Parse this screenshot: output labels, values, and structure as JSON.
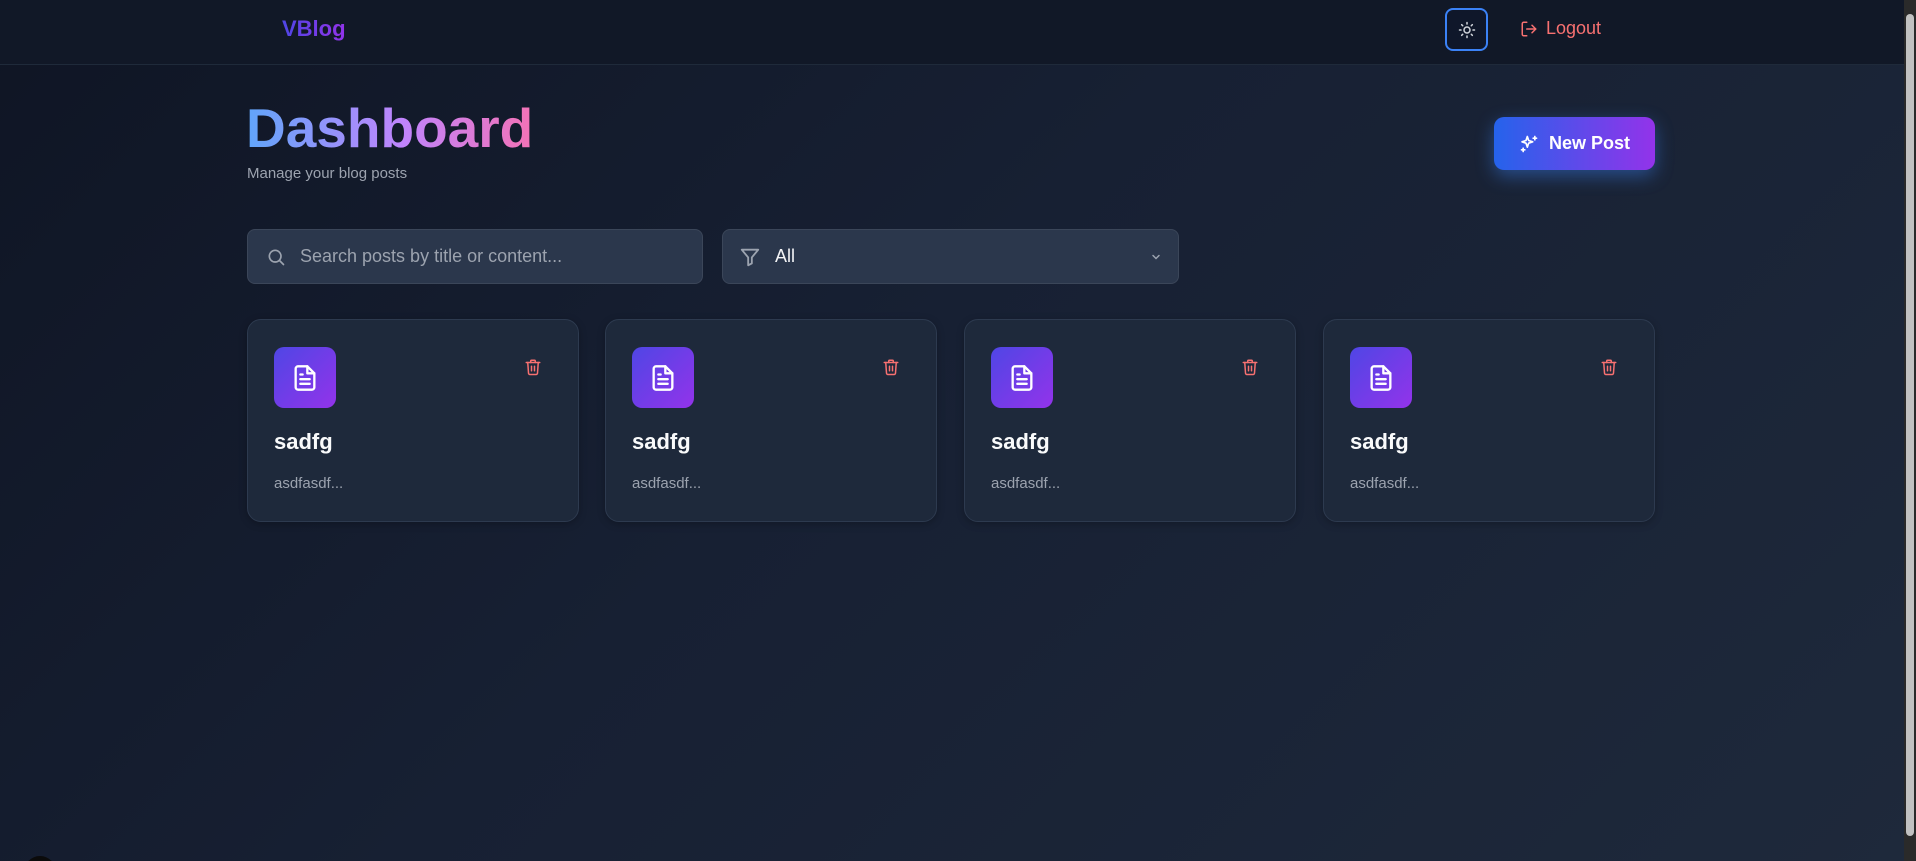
{
  "nav": {
    "logo": "VBlog",
    "logout_label": "Logout"
  },
  "header": {
    "title": "Dashboard",
    "subtitle": "Manage your blog posts",
    "new_post_label": "New Post"
  },
  "filters": {
    "search_placeholder": "Search posts by title or content...",
    "filter_value": "All"
  },
  "posts": [
    {
      "title": "sadfg",
      "excerpt": "asdfasdf..."
    },
    {
      "title": "sadfg",
      "excerpt": "asdfasdf..."
    },
    {
      "title": "sadfg",
      "excerpt": "asdfasdf..."
    },
    {
      "title": "sadfg",
      "excerpt": "asdfasdf..."
    }
  ],
  "icons": {
    "theme_toggle": "sun-icon",
    "logout": "logout-icon",
    "new_post": "sparkles-icon",
    "search": "search-icon",
    "filter": "filter-icon",
    "post": "file-text-icon",
    "delete": "trash-icon"
  },
  "colors": {
    "accent_blue": "#3b82f6",
    "accent_purple": "#9333ea",
    "danger": "#f87171",
    "background": "#172033"
  }
}
